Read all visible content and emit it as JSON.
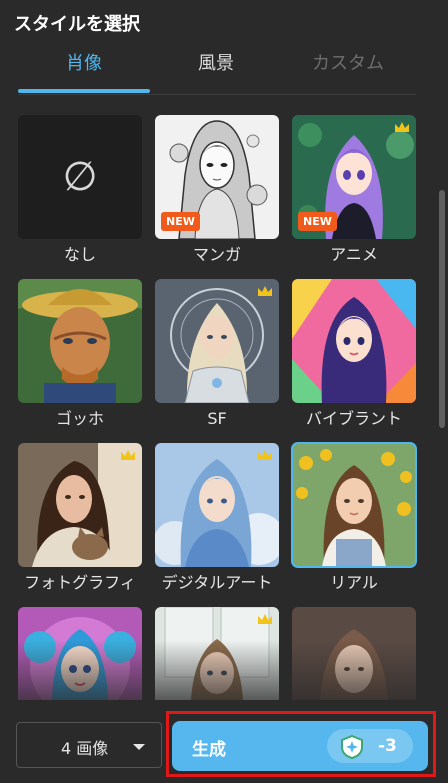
{
  "panel": {
    "title": "スタイルを選択"
  },
  "tabs": [
    {
      "label": "肖像",
      "active": true
    },
    {
      "label": "風景",
      "active": false
    },
    {
      "label": "カスタム",
      "active": false
    }
  ],
  "styles": [
    {
      "label": "なし",
      "symbol": "∅"
    },
    {
      "label": "マンガ",
      "badge": "NEW"
    },
    {
      "label": "アニメ",
      "badge": "NEW",
      "premium": true
    },
    {
      "label": "ゴッホ"
    },
    {
      "label": "SF",
      "premium": true
    },
    {
      "label": "バイブラント"
    },
    {
      "label": "フォトグラフィ",
      "premium": true
    },
    {
      "label": "デジタルアート",
      "premium": true
    },
    {
      "label": "リアル",
      "selected": true
    },
    {
      "label": ""
    },
    {
      "label": "",
      "premium": true
    },
    {
      "label": ""
    }
  ],
  "footer": {
    "image_count": "4 画像",
    "generate_label": "生成",
    "credit_cost": "-3"
  },
  "colors": {
    "accent": "#4fb6ee",
    "button": "#56b7ef",
    "highlight": "#e01818",
    "new_badge": "#f05a1a",
    "crown": "#f2c318"
  }
}
